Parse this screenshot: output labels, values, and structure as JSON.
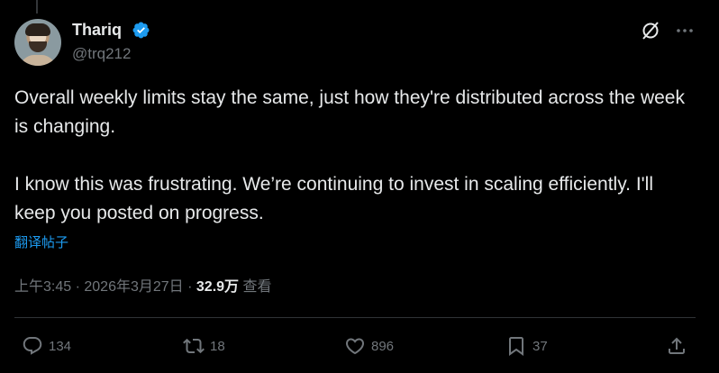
{
  "author": {
    "display_name": "Thariq",
    "handle": "@trq212",
    "verified": true,
    "avatar_icon": "avatar-photo"
  },
  "header_icons": {
    "grok": "grok-icon",
    "more": "more-options-icon"
  },
  "tweet": {
    "paragraph_1": "Overall weekly limits stay the same, just how they're distributed across the week is changing.",
    "paragraph_2": "I know this was frustrating. We’re continuing to invest in scaling efficiently. I'll keep you posted on progress.",
    "translate_label": "翻译帖子"
  },
  "meta": {
    "time": "上午3:45",
    "separator": " · ",
    "date": "2026年3月27日",
    "views_count": "32.9万",
    "views_label": "查看"
  },
  "actions": {
    "reply_count": "134",
    "retweet_count": "18",
    "like_count": "896",
    "bookmark_count": "37"
  },
  "colors": {
    "background": "#000000",
    "text": "#e7e9ea",
    "secondary": "#71767b",
    "accent": "#1d9bf0",
    "divider": "#2f3336"
  }
}
